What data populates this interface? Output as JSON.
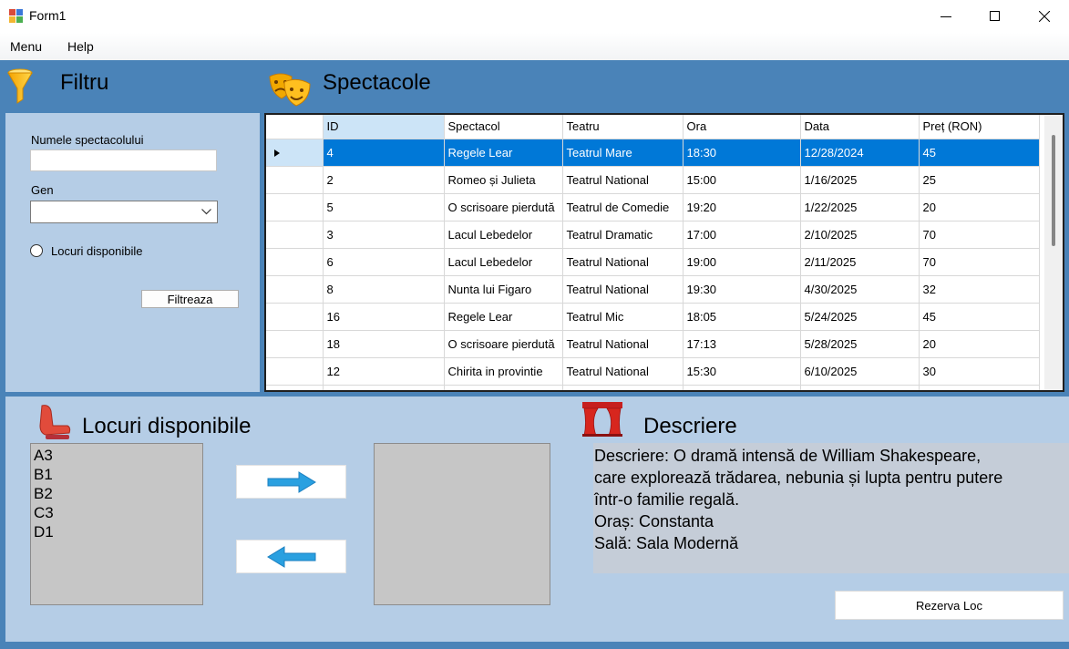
{
  "window": {
    "title": "Form1",
    "minimize_icon": "minimize-icon",
    "maximize_icon": "maximize-icon",
    "close_icon": "close-icon"
  },
  "menu": {
    "items": [
      {
        "label": "Menu"
      },
      {
        "label": "Help"
      }
    ]
  },
  "colors": {
    "main_background": "#4a83b8",
    "panel_background": "#b5cde6",
    "selection": "#0078d7",
    "header_selection": "#cce4f7",
    "arrow": "#2aa0e0"
  },
  "filter": {
    "title": "Filtru",
    "icon": "funnel-icon",
    "name_label": "Numele spectacolului",
    "name_value": "",
    "genre_label": "Gen",
    "genre_value": "",
    "available_label": "Locuri disponibile",
    "available_checked": false,
    "filter_button": "Filtreaza"
  },
  "shows": {
    "title": "Spectacole",
    "icon": "theater-masks-icon",
    "columns": [
      "ID",
      "Spectacol",
      "Teatru",
      "Ora",
      "Data",
      "Preț (RON)"
    ],
    "selected_index": 0,
    "rows": [
      {
        "id": "4",
        "show": "Regele Lear",
        "theater": "Teatrul Mare",
        "time": "18:30",
        "date": "12/28/2024",
        "price": "45"
      },
      {
        "id": "2",
        "show": "Romeo și Julieta",
        "theater": "Teatrul National",
        "time": "15:00",
        "date": "1/16/2025",
        "price": "25"
      },
      {
        "id": "5",
        "show": "O scrisoare pierdută",
        "theater": "Teatrul de Comedie",
        "time": "19:20",
        "date": "1/22/2025",
        "price": "20"
      },
      {
        "id": "3",
        "show": "Lacul Lebedelor",
        "theater": "Teatrul Dramatic",
        "time": "17:00",
        "date": "2/10/2025",
        "price": "70"
      },
      {
        "id": "6",
        "show": "Lacul Lebedelor",
        "theater": "Teatrul National",
        "time": "19:00",
        "date": "2/11/2025",
        "price": "70"
      },
      {
        "id": "8",
        "show": "Nunta lui Figaro",
        "theater": "Teatrul National",
        "time": "19:30",
        "date": "4/30/2025",
        "price": "32"
      },
      {
        "id": "16",
        "show": "Regele Lear",
        "theater": "Teatrul Mic",
        "time": "18:05",
        "date": "5/24/2025",
        "price": "45"
      },
      {
        "id": "18",
        "show": "O scrisoare pierdută",
        "theater": "Teatrul National",
        "time": "17:13",
        "date": "5/28/2025",
        "price": "20"
      },
      {
        "id": "12",
        "show": "Chirita in provintie",
        "theater": "Teatrul National",
        "time": "15:30",
        "date": "6/10/2025",
        "price": "30"
      }
    ]
  },
  "seats": {
    "title": "Locuri disponibile",
    "icon": "seat-icon",
    "available": [
      "A3",
      "B1",
      "B2",
      "C3",
      "D1"
    ],
    "selected": [],
    "add_icon": "arrow-right-icon",
    "remove_icon": "arrow-left-icon"
  },
  "description": {
    "title": "Descriere",
    "icon": "stage-curtain-icon",
    "lines": [
      "Descriere: O dramă intensă de William Shakespeare,",
      "care explorează trădarea, nebunia și lupta pentru putere",
      "într-o familie regală.",
      "Oraș: Constanta",
      "Sală: Sala Modernă"
    ],
    "reserve_button": "Rezerva Loc"
  }
}
